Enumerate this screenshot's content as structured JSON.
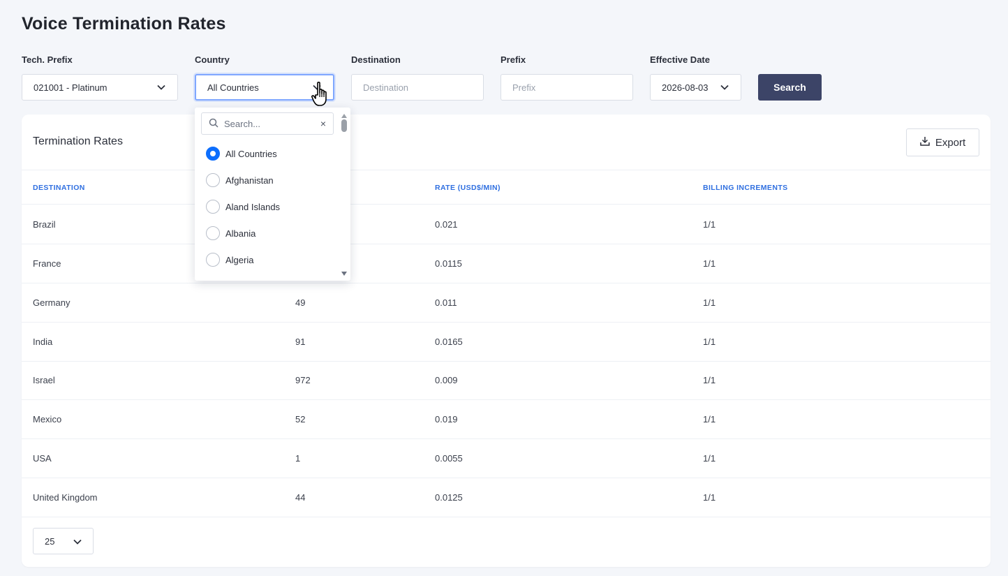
{
  "page": {
    "title": "Voice Termination Rates"
  },
  "filters": {
    "tech_prefix": {
      "label": "Tech. Prefix",
      "value": "021001 - Platinum"
    },
    "country": {
      "label": "Country",
      "value": "All Countries"
    },
    "destination": {
      "label": "Destination",
      "placeholder": "Destination"
    },
    "prefix": {
      "label": "Prefix",
      "placeholder": "Prefix"
    },
    "effective_date": {
      "label": "Effective Date",
      "value": "2026-08-03"
    },
    "search_label": "Search"
  },
  "country_dropdown": {
    "search_placeholder": "Search...",
    "clear_glyph": "×",
    "options": [
      {
        "label": "All Countries",
        "selected": true
      },
      {
        "label": "Afghanistan",
        "selected": false
      },
      {
        "label": "Aland Islands",
        "selected": false
      },
      {
        "label": "Albania",
        "selected": false
      },
      {
        "label": "Algeria",
        "selected": false
      }
    ]
  },
  "card": {
    "title": "Termination Rates",
    "export_label": "Export"
  },
  "table": {
    "columns": [
      "DESTINATION",
      "",
      "RATE (USD$/MIN)",
      "BILLING INCREMENTS"
    ],
    "rows": [
      [
        "Brazil",
        "",
        "0.021",
        "1/1"
      ],
      [
        "France",
        "",
        "0.0115",
        "1/1"
      ],
      [
        "Germany",
        "49",
        "0.011",
        "1/1"
      ],
      [
        "India",
        "91",
        "0.0165",
        "1/1"
      ],
      [
        "Israel",
        "972",
        "0.009",
        "1/1"
      ],
      [
        "Mexico",
        "52",
        "0.019",
        "1/1"
      ],
      [
        "USA",
        "1",
        "0.0055",
        "1/1"
      ],
      [
        "United Kingdom",
        "44",
        "0.0125",
        "1/1"
      ]
    ]
  },
  "pager": {
    "page_size": "25"
  },
  "icons": {
    "chevron": "chevron-down-icon",
    "search": "search-icon",
    "download": "download-icon",
    "cursor": "hand-pointer-icon"
  },
  "colors": {
    "primary_button": "#3c4467",
    "header_text": "#2f6fe0",
    "radio_selected": "#0d6efd",
    "focus_border": "#7fa7ff"
  }
}
